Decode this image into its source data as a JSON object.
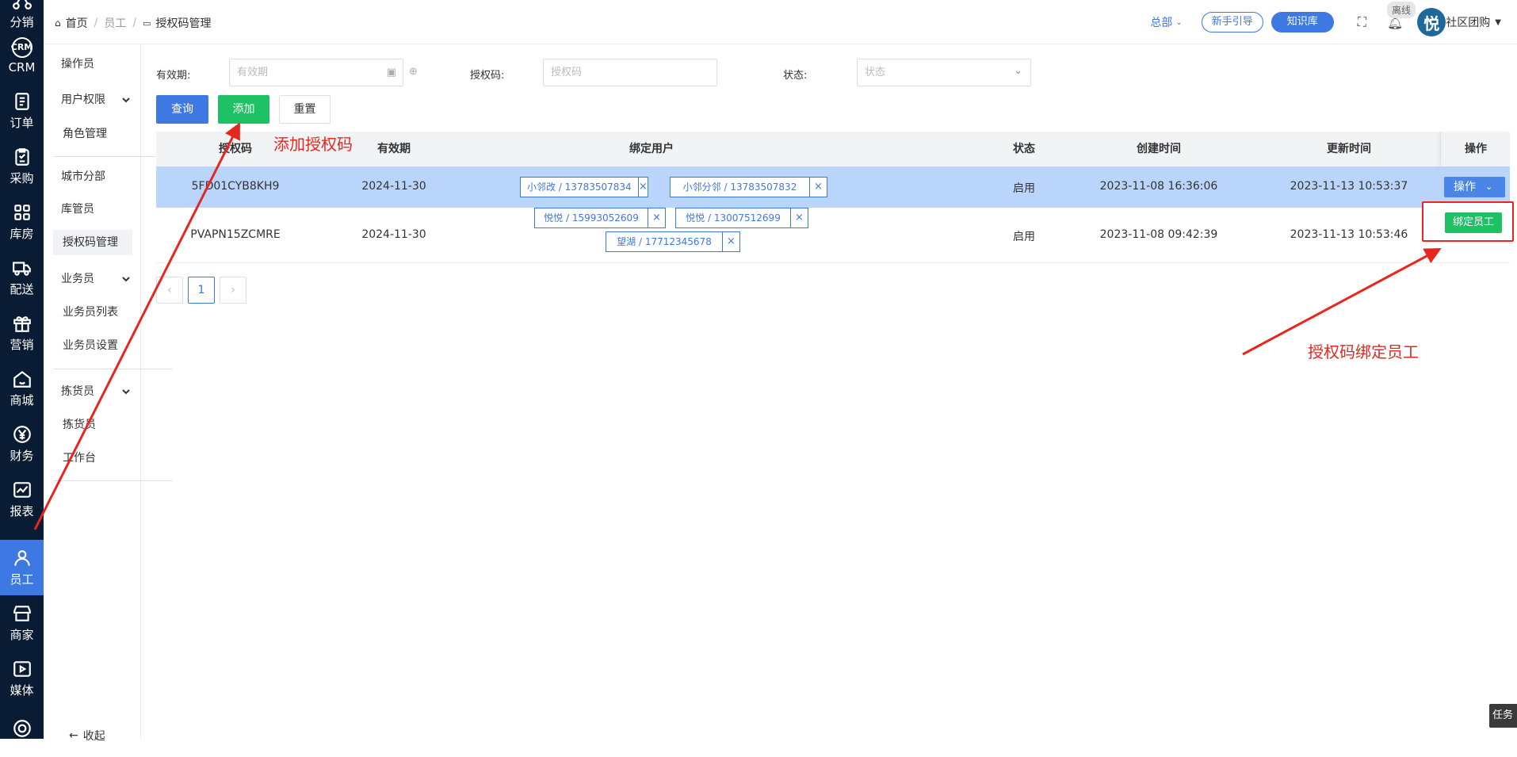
{
  "rail": [
    {
      "label": "分销",
      "icon": "share-nodes-icon"
    },
    {
      "label": "CRM",
      "icon": "crm-icon"
    },
    {
      "label": "订单",
      "icon": "order-icon"
    },
    {
      "label": "采购",
      "icon": "purchase-icon"
    },
    {
      "label": "库房",
      "icon": "warehouse-icon"
    },
    {
      "label": "配送",
      "icon": "truck-icon"
    },
    {
      "label": "营销",
      "icon": "gift-icon"
    },
    {
      "label": "商城",
      "icon": "house-icon"
    },
    {
      "label": "财务",
      "icon": "yuan-icon"
    },
    {
      "label": "报表",
      "icon": "chart-icon"
    },
    {
      "label": "员工",
      "icon": "user-icon"
    },
    {
      "label": "商家",
      "icon": "store-icon"
    },
    {
      "label": "媒体",
      "icon": "media-icon"
    }
  ],
  "subnav": {
    "items": [
      "操作员",
      "用户权限",
      "角色管理",
      "城市分部",
      "库管员",
      "授权码管理",
      "业务员",
      "业务员列表",
      "业务员设置",
      "拣货员",
      "拣货员",
      "工作台"
    ],
    "collapse": "收起"
  },
  "header": {
    "breadcrumb": [
      "首页",
      "员工",
      "授权码管理"
    ],
    "region": "总部",
    "guide_button": "新手引导",
    "knowledge_button": "知识库",
    "offline_badge": "离线",
    "avatar_text": "悦",
    "store_name": "社区团购"
  },
  "filters": {
    "validity_label": "有效期:",
    "validity_placeholder": "有效期",
    "code_label": "授权码:",
    "code_placeholder": "授权码",
    "status_label": "状态:",
    "status_placeholder": "状态"
  },
  "buttons": {
    "query": "查询",
    "add": "添加",
    "reset": "重置"
  },
  "table": {
    "columns": [
      "授权码",
      "有效期",
      "绑定用户",
      "状态",
      "创建时间",
      "更新时间",
      "操作"
    ],
    "rows": [
      {
        "code": "5FD01CYB8KH9",
        "validity": "2024-11-30",
        "users": [
          "小邻改 / 13783507834",
          "小邻分邻 / 13783507832"
        ],
        "status": "启用",
        "created": "2023-11-08 16:36:06",
        "updated": "2023-11-13 10:53:37"
      },
      {
        "code": "PVAPN15ZCMRE",
        "validity": "2024-11-30",
        "users": [
          "悦悦 / 15993052609",
          "悦悦 / 13007512699",
          "望湖 / 17712345678"
        ],
        "status": "启用",
        "created": "2023-11-08 09:42:39",
        "updated": "2023-11-13 10:53:46"
      }
    ],
    "op_button": "操作",
    "bind_button": "绑定员工"
  },
  "pagination": {
    "current": "1"
  },
  "annotations": {
    "add": "添加授权码",
    "bind": "授权码绑定员工"
  },
  "task_tab": "任务",
  "colors": {
    "rail_bg": "#0a1c33",
    "primary": "#3d78e3",
    "green": "#1ec264",
    "annotation": "#e7271e",
    "row_highlight": "#b9d5fb"
  }
}
